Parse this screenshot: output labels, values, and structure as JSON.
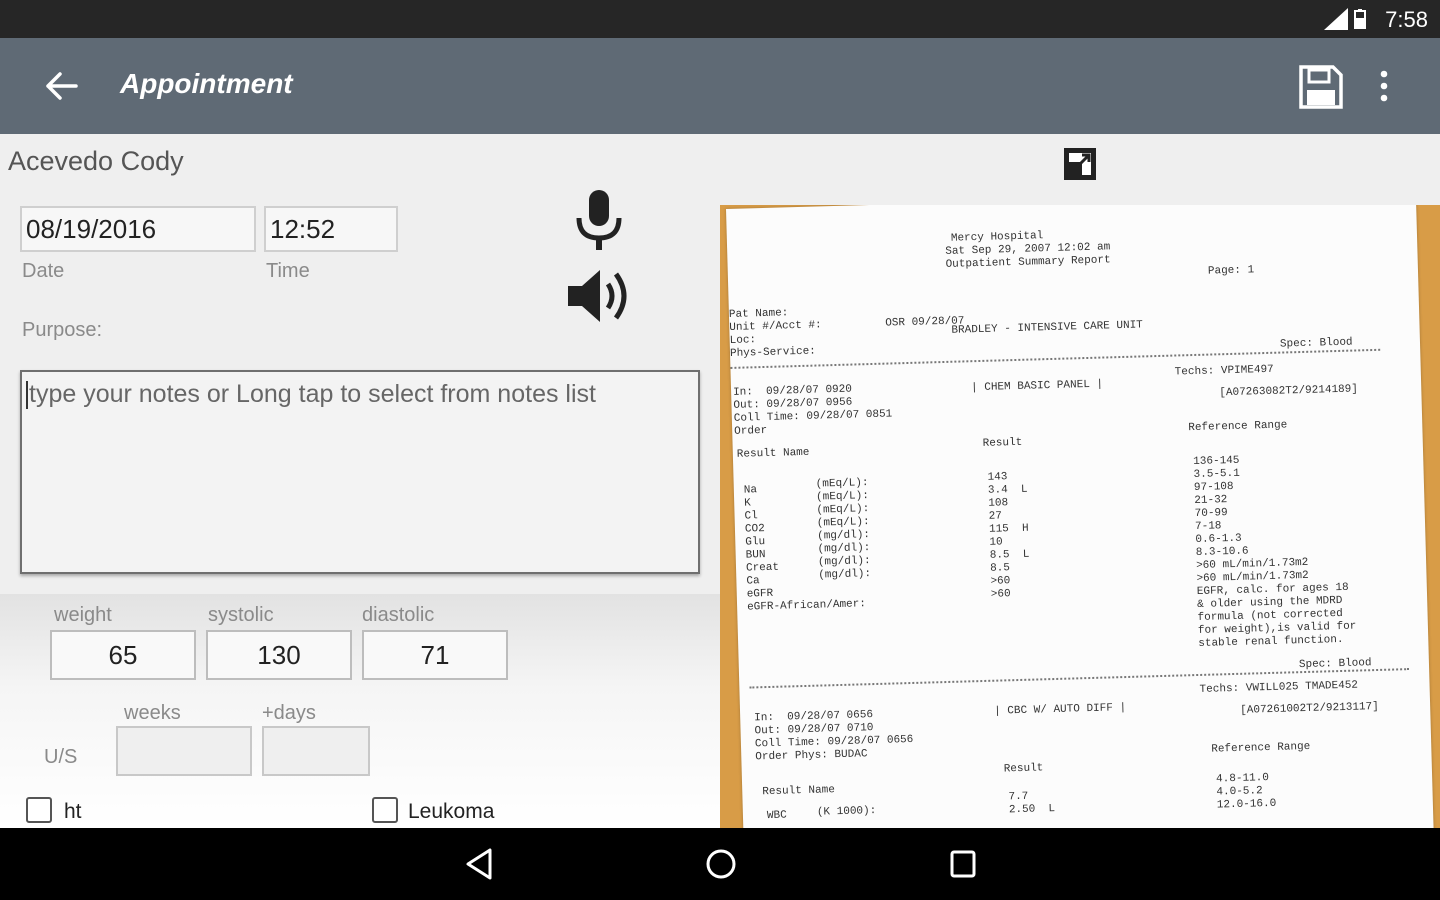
{
  "status": {
    "time": "7:58"
  },
  "appbar": {
    "title": "Appointment"
  },
  "patient": {
    "name": "Acevedo Cody"
  },
  "date": {
    "value": "08/19/2016",
    "label": "Date"
  },
  "time": {
    "value": "12:52",
    "label": "Time"
  },
  "purpose": {
    "label": "Purpose:",
    "placeholder": "type your notes or Long tap to select from notes list"
  },
  "vitals": {
    "weight_label": "weight",
    "weight": "65",
    "systolic_label": "systolic",
    "systolic": "130",
    "diastolic_label": "diastolic",
    "diastolic": "71",
    "weeks_label": "weeks",
    "days_label": "+days",
    "us_label": "U/S"
  },
  "checks": {
    "ht": "ht",
    "leukoma": "Leukoma"
  },
  "doc": {
    "lines": [
      "Mercy Hospital",
      "Sat Sep 29, 2007 12:02 am",
      "Outpatient Summary Report",
      "Page: 1",
      "Pat Name:",
      "Unit #/Acct #:",
      "Loc:",
      "Phys-Service:",
      "OSR 09/28/07",
      "BRADLEY - INTENSIVE CARE UNIT",
      "Spec: Blood",
      "In:  09/28/07 0920",
      "Out: 09/28/07 0956",
      "Coll Time: 09/28/07 0851",
      "Order",
      "| CHEM BASIC PANEL |",
      "Techs: VPIME497",
      "[A07263082T2/9214189]",
      "Result Name",
      "Result",
      "Reference Range",
      "Na",
      "K",
      "Cl",
      "CO2",
      "Glu",
      "BUN",
      "Creat",
      "Ca",
      "eGFR",
      "eGFR-African/Amer:",
      "(mEq/L):",
      "(mEq/L):",
      "(mEq/L):",
      "(mEq/L):",
      "(mg/dl):",
      "(mg/dl):",
      "(mg/dl):",
      "(mg/dl):",
      "143",
      "3.4  L",
      "108",
      "27",
      "115  H",
      "10",
      "8.5  L",
      "8.5",
      ">60",
      ">60",
      "136-145",
      "3.5-5.1",
      "97-108",
      "21-32",
      "70-99",
      "7-18",
      "0.6-1.3",
      "8.3-10.6",
      ">60 mL/min/1.73m2",
      ">60 mL/min/1.73m2",
      "EGFR, calc. for ages 18",
      "& older using the MDRD",
      "formula (not corrected",
      "for weight),is valid for",
      "stable renal function.",
      "Spec: Blood",
      "Techs: VWILL025 TMADE452",
      "In:  09/28/07 0656",
      "Out: 09/28/07 0710",
      "Coll Time: 09/28/07 0656",
      "Order Phys: BUDAC",
      "| CBC W/ AUTO DIFF |",
      "[A07261002T2/9213117]",
      "Result",
      "Reference Range",
      "Result Name",
      "WBC",
      "(K 1000):",
      "7.7",
      "2.50  L",
      "4.8-11.0",
      "4.0-5.2",
      "12.0-16.0"
    ]
  }
}
